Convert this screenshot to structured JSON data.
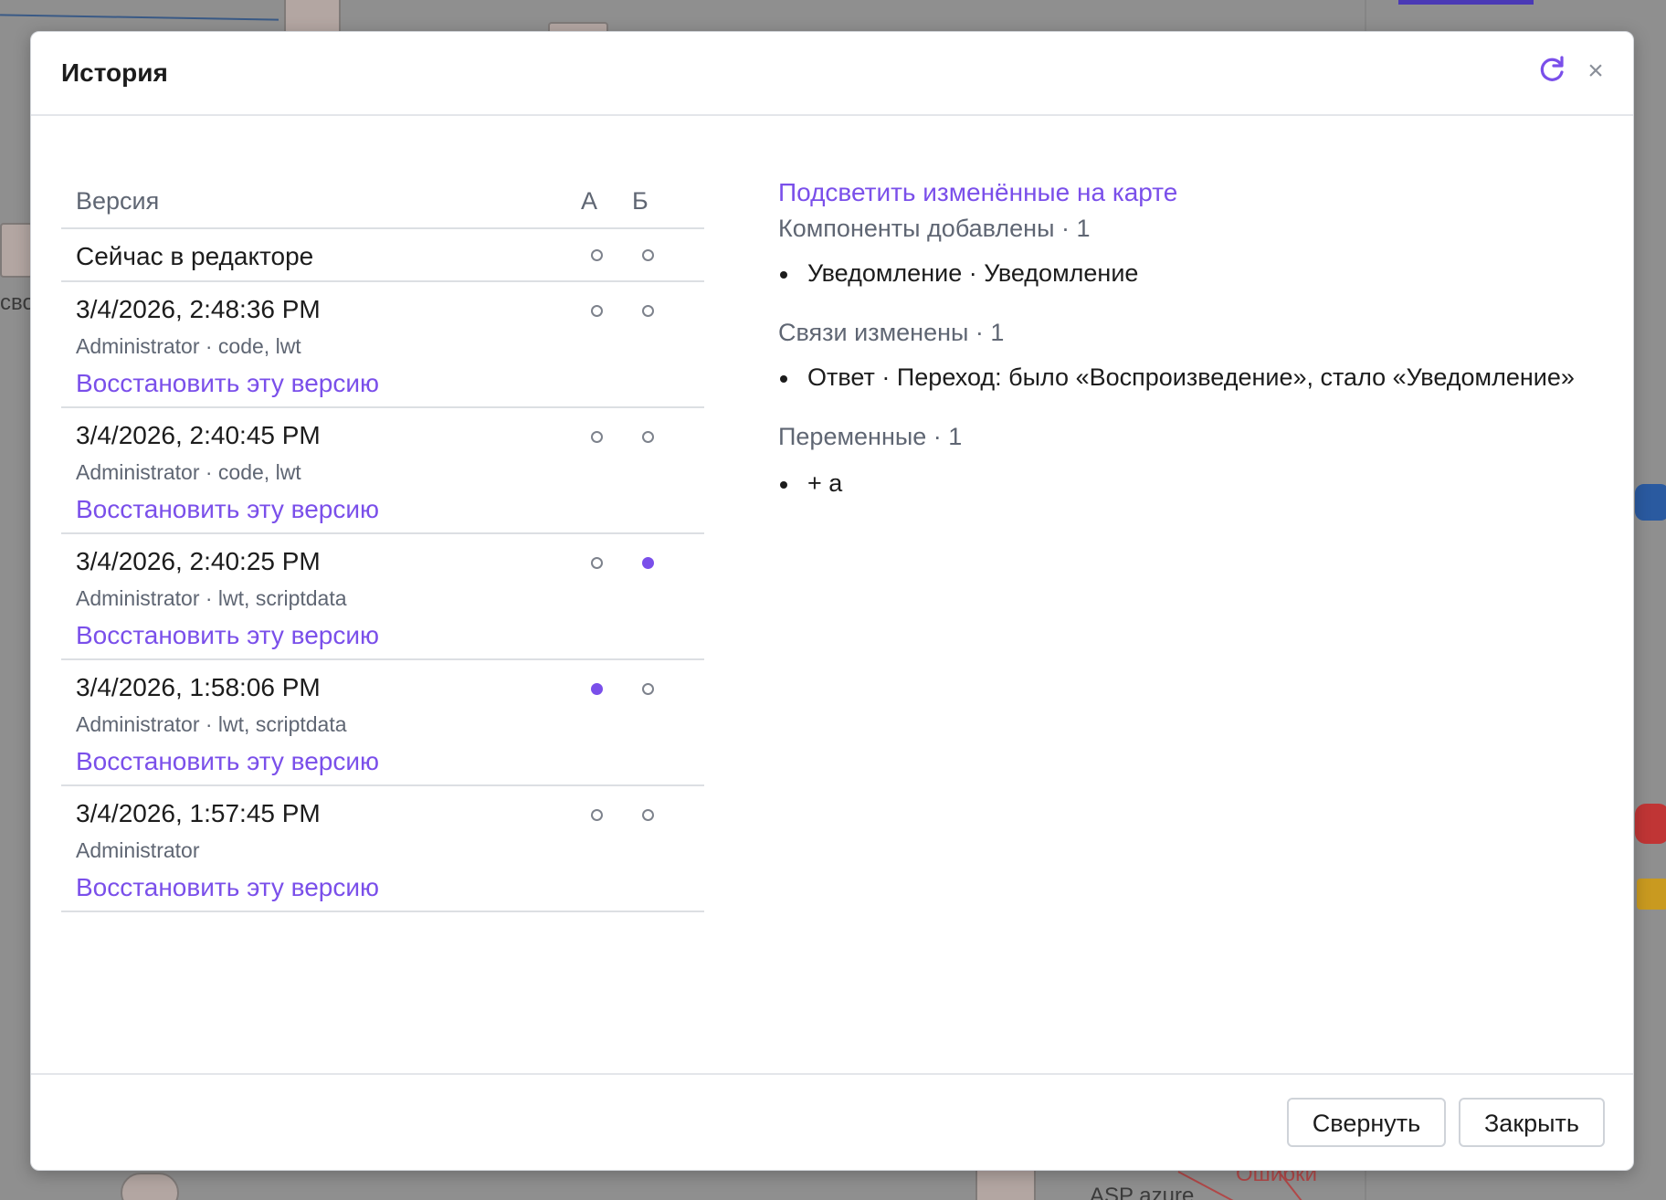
{
  "dialog": {
    "title": "История",
    "refresh_icon": "refresh-icon",
    "close_icon": "close-icon",
    "close_glyph": "×"
  },
  "versions": {
    "headers": {
      "version": "Версия",
      "a": "А",
      "b": "Б"
    },
    "current": {
      "label": "Сейчас в редакторе",
      "a_selected": false,
      "b_selected": false
    },
    "rows": [
      {
        "date": "3/4/2026, 2:48:36 PM",
        "meta": "Administrator · code, lwt",
        "restore": "Восстановить эту версию",
        "a_selected": false,
        "b_selected": false
      },
      {
        "date": "3/4/2026, 2:40:45 PM",
        "meta": "Administrator · code, lwt",
        "restore": "Восстановить эту версию",
        "a_selected": false,
        "b_selected": false
      },
      {
        "date": "3/4/2026, 2:40:25 PM",
        "meta": "Administrator · lwt, scriptdata",
        "restore": "Восстановить эту версию",
        "a_selected": false,
        "b_selected": true
      },
      {
        "date": "3/4/2026, 1:58:06 PM",
        "meta": "Administrator · lwt, scriptdata",
        "restore": "Восстановить эту версию",
        "a_selected": true,
        "b_selected": false
      },
      {
        "date": "3/4/2026, 1:57:45 PM",
        "meta": "Administrator",
        "restore": "Восстановить эту версию",
        "a_selected": false,
        "b_selected": false
      }
    ]
  },
  "diff": {
    "highlight_link": "Подсветить изменённые на карте",
    "sections": [
      {
        "title": "Компоненты добавлены · 1",
        "items": [
          "Уведомление · Уведомление"
        ]
      },
      {
        "title": "Связи изменены · 1",
        "items": [
          "Ответ · Переход: было «Воспроизведение», стало «Уведомление»"
        ]
      },
      {
        "title": "Переменные · 1",
        "items": [
          "+ a"
        ]
      }
    ]
  },
  "footer": {
    "collapse_label": "Свернуть",
    "close_label": "Закрыть"
  },
  "background": {
    "fragments": [
      "сво",
      "ASP azure",
      "Ошибки"
    ]
  },
  "colors": {
    "accent": "#7a4fea",
    "muted": "#5f6673",
    "text": "#1c1c1c",
    "overlay": "#8f8f8f"
  }
}
